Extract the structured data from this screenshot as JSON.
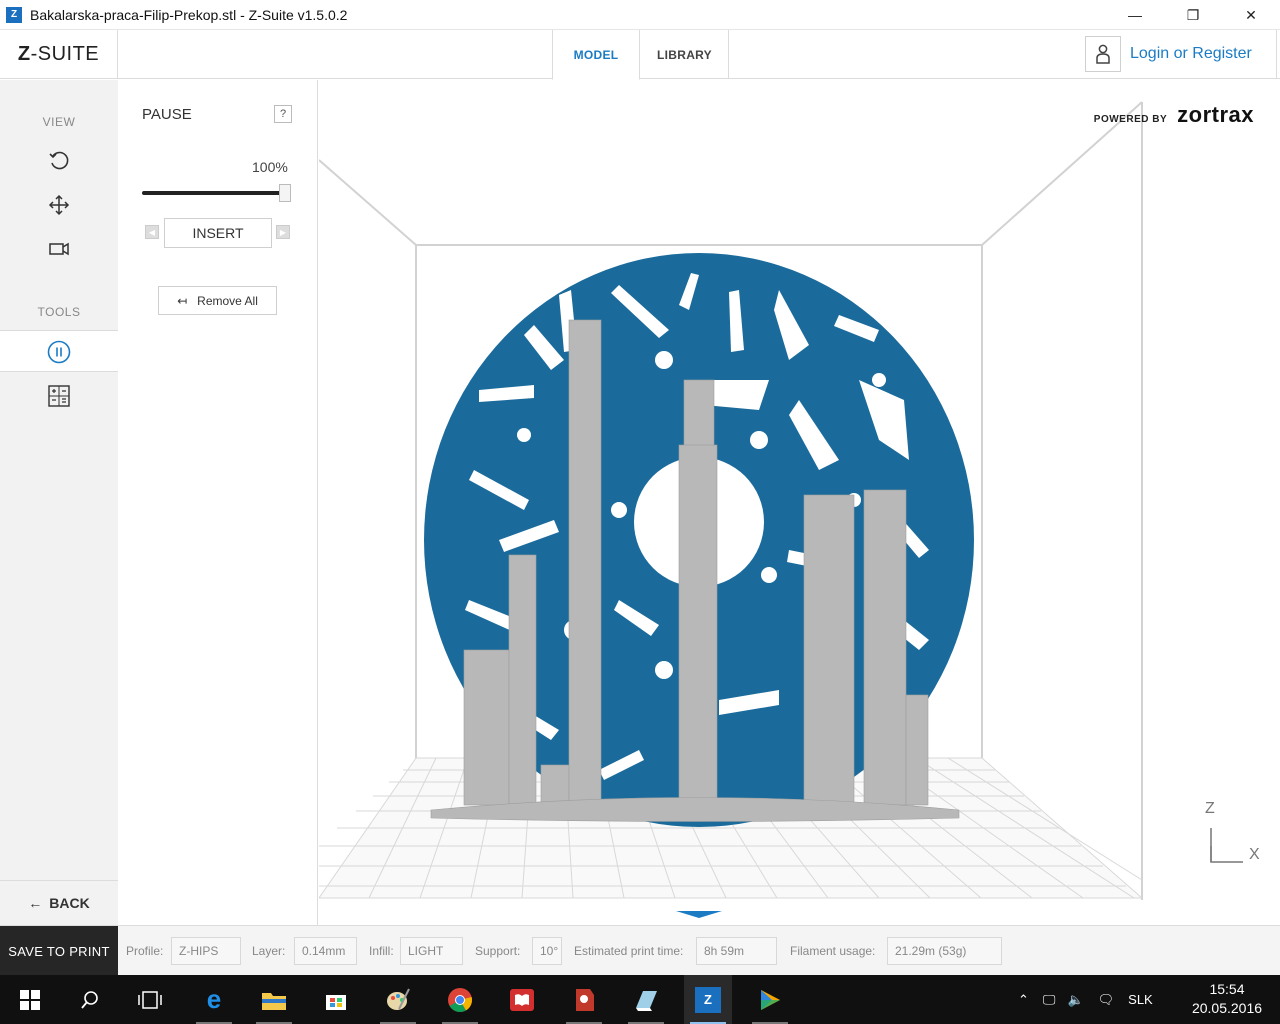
{
  "window": {
    "title": "Bakalarska-praca-Filip-Prekop.stl - Z-Suite v1.5.0.2",
    "app_icon": "Z",
    "minimize": "—",
    "restore": "❐",
    "close": "✕"
  },
  "header": {
    "logo_prefix": "Z",
    "logo_suffix": "-SUITE",
    "tabs": [
      {
        "label": "MODEL",
        "active": true
      },
      {
        "label": "LIBRARY",
        "active": false
      }
    ],
    "login_label": "Login or Register"
  },
  "sidebar": {
    "view_label": "VIEW",
    "view_tools": [
      "rotate-icon",
      "move-icon",
      "camera-icon"
    ],
    "tools_label": "TOOLS",
    "tools": [
      "pause-icon",
      "calculator-icon"
    ],
    "back_label": "BACK"
  },
  "panel": {
    "title": "PAUSE",
    "help_label": "?",
    "percent": "100%",
    "slider_value": 1.0,
    "insert_label": "INSERT",
    "remove_all_label": "Remove All"
  },
  "viewport": {
    "powered_by": "POWERED BY",
    "brand": "zortrax",
    "axis_z": "Z",
    "axis_x": "X",
    "model_color": "#1a6b9c",
    "support_color": "#b8b8b8"
  },
  "statusbar": {
    "save_label": "SAVE TO PRINT",
    "profile_label": "Profile:",
    "profile_value": "Z-HIPS",
    "layer_label": "Layer:",
    "layer_value": "0.14mm",
    "infill_label": "Infill:",
    "infill_value": "LIGHT",
    "support_label": "Support:",
    "support_value": "10°",
    "time_label": "Estimated print time:",
    "time_value": "8h 59m",
    "filament_label": "Filament usage:",
    "filament_value": "21.29m (53g)"
  },
  "taskbar": {
    "language": "SLK",
    "time": "15:54",
    "date": "20.05.2016",
    "apps": [
      "windows-start-icon",
      "search-icon",
      "task-view-icon",
      "edge-icon",
      "file-explorer-icon",
      "store-icon",
      "paint-icon",
      "chrome-icon",
      "reader-icon",
      "app-red-icon",
      "sketch-icon",
      "zsuite-icon",
      "media-player-icon"
    ]
  }
}
